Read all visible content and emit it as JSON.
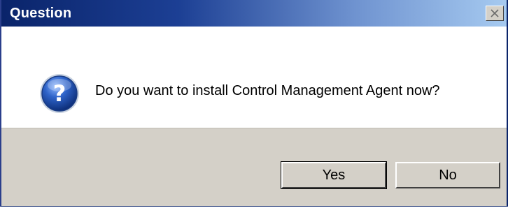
{
  "window": {
    "title": "Question",
    "close_icon": "close-icon",
    "titlebar_colors": [
      "#0a246a",
      "#a6caf0"
    ]
  },
  "dialog": {
    "icon": "question-icon",
    "message": "Do you want to install Control Management Agent now?"
  },
  "buttons": {
    "yes_label": "Yes",
    "no_label": "No"
  }
}
